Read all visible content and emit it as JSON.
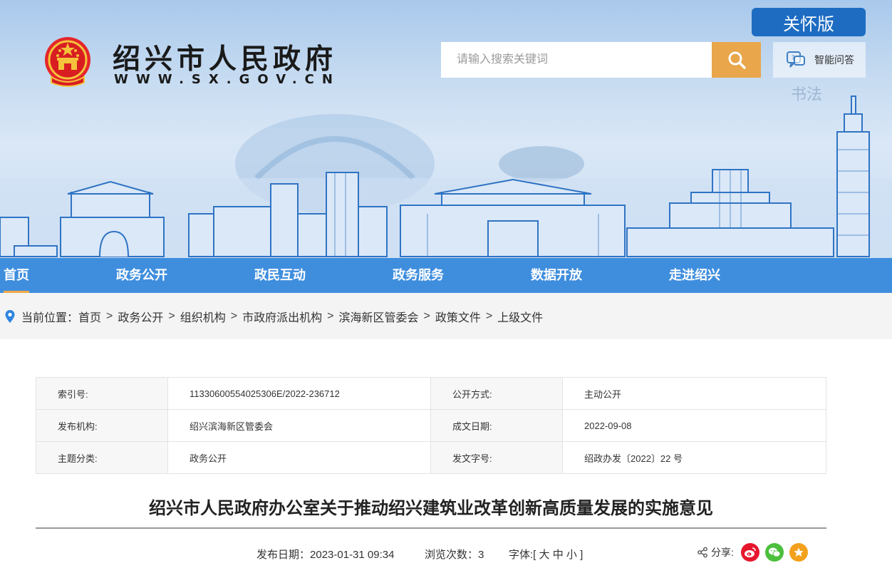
{
  "header": {
    "site_title": "绍兴市人民政府",
    "site_url": "WWW.SX.GOV.CN",
    "care_mode_label": "关怀版",
    "search_placeholder": "请输入搜索关键词",
    "qa_label": "智能问答"
  },
  "nav": {
    "items": [
      {
        "label": "首页",
        "active": true
      },
      {
        "label": "政务公开"
      },
      {
        "label": "政民互动"
      },
      {
        "label": "政务服务"
      },
      {
        "label": "数据开放"
      },
      {
        "label": "走进绍兴"
      }
    ]
  },
  "breadcrumb": {
    "prefix": "当前位置：",
    "items": [
      "首页",
      "政务公开",
      "组织机构",
      "市政府派出机构",
      "滨海新区管委会",
      "政策文件",
      "上级文件"
    ],
    "separator": ">"
  },
  "metadata": {
    "rows": [
      {
        "k1": "索引号:",
        "v1": "11330600554025306E/2022-236712",
        "k2": "公开方式:",
        "v2": "主动公开"
      },
      {
        "k1": "发布机构:",
        "v1": "绍兴滨海新区管委会",
        "k2": "成文日期:",
        "v2": "2022-09-08"
      },
      {
        "k1": "主题分类:",
        "v1": "政务公开",
        "k2": "发文字号:",
        "v2": "绍政办发〔2022〕22 号"
      }
    ]
  },
  "article": {
    "title": "绍兴市人民政府办公室关于推动绍兴建筑业改革创新高质量发展的实施意见",
    "publish_label": "发布日期：",
    "publish_date": "2023-01-31 09:34",
    "views_label": "浏览次数：",
    "views": "3",
    "font_label": "字体:[",
    "font_large": "大",
    "font_medium": "中",
    "font_small": "小",
    "font_close": "]",
    "share_label": "分享:"
  },
  "colors": {
    "nav_bg": "#3f8ede",
    "care_btn": "#1d6cc2",
    "search_btn": "#e9a64b",
    "weibo": "#e6162d",
    "wechat": "#4cbf3c",
    "favorite": "#f3a11d"
  }
}
